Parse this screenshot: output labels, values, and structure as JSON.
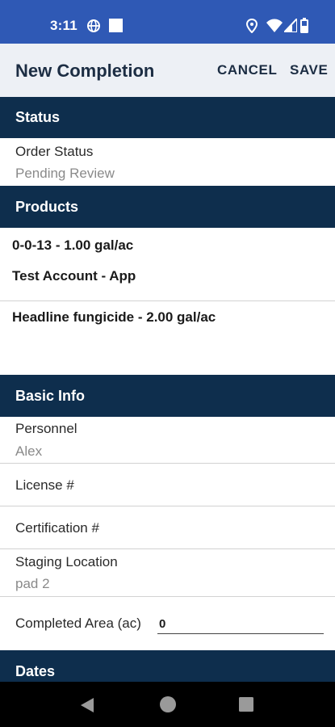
{
  "status_bar": {
    "time": "3:11",
    "icons": [
      "vpn-globe-icon",
      "notification-square-icon",
      "location-pin-icon",
      "wifi-icon",
      "signal-icon",
      "battery-icon"
    ],
    "color": "#2f59b5"
  },
  "header": {
    "title": "New Completion",
    "cancel_label": "CANCEL",
    "save_label": "SAVE"
  },
  "sections": {
    "status": {
      "title": "Status",
      "order_status_label": "Order Status",
      "order_status_value": "Pending Review"
    },
    "products": {
      "title": "Products",
      "items": [
        {
          "name": "0-0-13 - 1.00 gal/ac",
          "account": "Test Account - App"
        },
        {
          "name": "Headline fungicide - 2.00 gal/ac"
        }
      ]
    },
    "basic_info": {
      "title": "Basic Info",
      "personnel_label": "Personnel",
      "personnel_value": "Alex",
      "license_label": "License #",
      "certification_label": "Certification #",
      "staging_label": "Staging Location",
      "staging_value": "pad 2",
      "completed_area_label": "Completed Area (ac)",
      "completed_area_value": "0"
    },
    "dates": {
      "title": "Dates"
    }
  },
  "colors": {
    "section_header": "#0e2e4d",
    "app_bar": "#edf0f5",
    "title_text": "#1c2d43"
  },
  "nav_bar": {
    "icons": [
      "back-triangle-icon",
      "home-circle-icon",
      "recents-square-icon"
    ]
  }
}
